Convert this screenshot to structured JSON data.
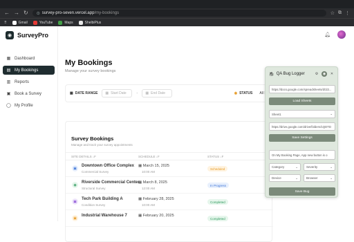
{
  "browser": {
    "url_host": "survey-pro-seven.vercel.app",
    "url_path": "/my-bookings",
    "bookmarks": [
      {
        "label": "Gmail",
        "color": "#ffffff"
      },
      {
        "label": "YouTube",
        "color": "#e53935"
      },
      {
        "label": "Maps",
        "color": "#43a047"
      },
      {
        "label": "ShelbiPlus",
        "color": "#e8e8e8"
      }
    ]
  },
  "brand": {
    "name": "SurveyPro"
  },
  "sidebar": {
    "items": [
      {
        "label": "Dashboard",
        "icon": "dashboard-icon",
        "glyph": "▦"
      },
      {
        "label": "My Bookings",
        "icon": "bookings-icon",
        "glyph": "▤"
      },
      {
        "label": "Reports",
        "icon": "reports-icon",
        "glyph": "▥"
      },
      {
        "label": "Book a Survey",
        "icon": "calendar-plus-icon",
        "glyph": "▣"
      },
      {
        "label": "My Profile",
        "icon": "user-icon",
        "glyph": "◯"
      }
    ]
  },
  "page": {
    "title": "My Bookings",
    "subtitle": "Manage your survey bookings"
  },
  "filters": {
    "date_range_label": "DATE RANGE",
    "start_placeholder": "Start Date",
    "end_placeholder": "End Date",
    "status_label": "STATUS",
    "status_value": "All St"
  },
  "bookings": {
    "title": "Survey Bookings",
    "subtitle": "Manage and track your survey appointments",
    "columns": [
      "SITE DETAILS ↓F",
      "SCHEDULE ↓F",
      "STATUS ↓F"
    ],
    "rows": [
      {
        "name": "Downtown Office Complex",
        "type": "Commercial Survey",
        "date": "March 15, 2025",
        "time": "10:00 AM",
        "status": "Scheduled",
        "kind": "sched",
        "icon_color": "#3b73d6",
        "icon_bg": "#e8f0fd"
      },
      {
        "name": "Riverside Commercial Center",
        "type": "Structural Survey",
        "date": "March 8, 2025",
        "time": "12:00 AM",
        "status": "In Progress",
        "kind": "prog",
        "icon_color": "#2f9a5e",
        "icon_bg": "#e6f6ec"
      },
      {
        "name": "Tech Park Building A",
        "type": "Condition Survey",
        "date": "February 28, 2025",
        "time": "10:00 AM",
        "status": "Completed",
        "kind": "done",
        "icon_color": "#8a4fd6",
        "icon_bg": "#f0e8fb"
      },
      {
        "name": "Industrial Warehouse 7",
        "type": "",
        "date": "February 20, 2025",
        "time": "",
        "status": "Completed",
        "kind": "done",
        "icon_color": "#e69a25",
        "icon_bg": "#fff3e0"
      }
    ]
  },
  "qa_logger": {
    "title": "QA Bug Logger",
    "sheet_url": "https://docs.google.com/spreadsheets/d/1l2...",
    "load_sheets_label": "Load Sheets",
    "sheet_value": "Sheet1",
    "drive_url": "https://drive.google.com/drive/folders/1QDTD",
    "save_settings_label": "Save Settings",
    "bug_text": "On My Booking Page, App new button is o",
    "category": "Category",
    "severity": "Severity",
    "device": "Device",
    "browser": "Browser",
    "save_bug_label": "Save Bug"
  }
}
